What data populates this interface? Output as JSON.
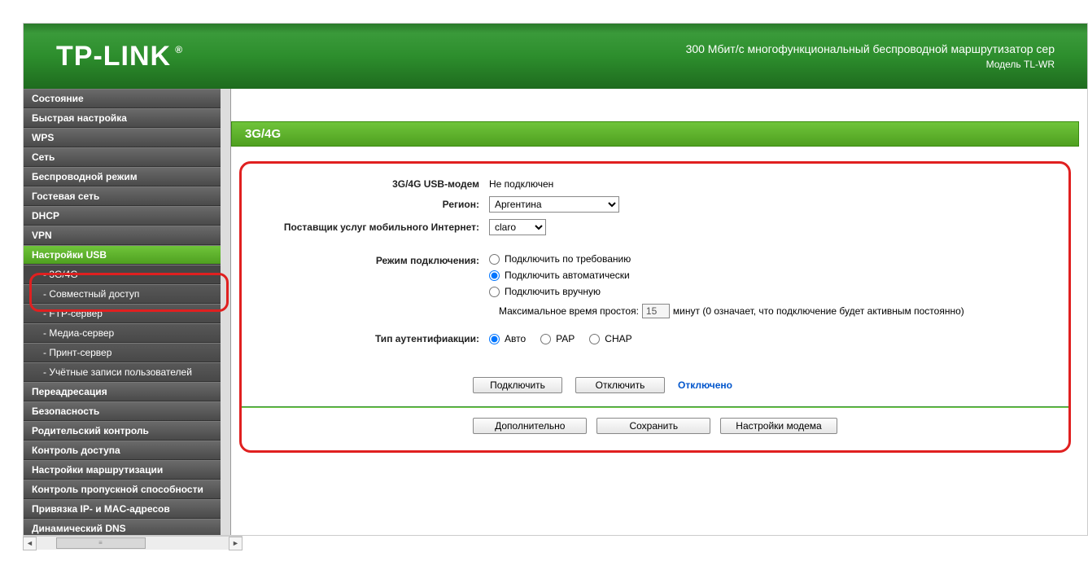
{
  "header": {
    "logo": "TP-LINK",
    "title": "300 Мбит/с многофункциональный беспроводной маршрутизатор сер",
    "model": "Модель TL-WR"
  },
  "sidebar": {
    "items": [
      {
        "label": "Состояние",
        "type": "top"
      },
      {
        "label": "Быстрая настройка",
        "type": "top"
      },
      {
        "label": "WPS",
        "type": "top"
      },
      {
        "label": "Сеть",
        "type": "top"
      },
      {
        "label": "Беспроводной режим",
        "type": "top"
      },
      {
        "label": "Гостевая сеть",
        "type": "top"
      },
      {
        "label": "DHCP",
        "type": "top"
      },
      {
        "label": "VPN",
        "type": "top"
      },
      {
        "label": "Настройки USB",
        "type": "active"
      },
      {
        "label": "- 3G/4G",
        "type": "active_child"
      },
      {
        "label": "- Совместный доступ",
        "type": "child"
      },
      {
        "label": "- FTP-сервер",
        "type": "child"
      },
      {
        "label": "- Медиа-сервер",
        "type": "child"
      },
      {
        "label": "- Принт-сервер",
        "type": "child"
      },
      {
        "label": "- Учётные записи пользователей",
        "type": "child"
      },
      {
        "label": "Переадресация",
        "type": "top"
      },
      {
        "label": "Безопасность",
        "type": "top"
      },
      {
        "label": "Родительский контроль",
        "type": "top"
      },
      {
        "label": "Контроль доступа",
        "type": "top"
      },
      {
        "label": "Настройки маршрутизации",
        "type": "top"
      },
      {
        "label": "Контроль пропускной способности",
        "type": "top"
      },
      {
        "label": "Привязка IP- и MAC-адресов",
        "type": "top"
      },
      {
        "label": "Динамический DNS",
        "type": "top"
      }
    ]
  },
  "section": {
    "title": "3G/4G"
  },
  "form": {
    "modem_label": "3G/4G USB-модем",
    "modem_value": "Не подключен",
    "region_label": "Регион:",
    "region_value": "Аргентина",
    "isp_label": "Поставщик услуг мобильного Интернет:",
    "isp_value": "claro",
    "conn_mode_label": "Режим подключения:",
    "conn_modes": {
      "on_demand": "Подключить по требованию",
      "auto": "Подключить автоматически",
      "manual": "Подключить вручную"
    },
    "idle_label": "Максимальное время простоя:",
    "idle_value": "15",
    "idle_suffix": "минут (0 означает, что подключение будет активным постоянно)",
    "auth_label": "Тип аутентифиакции:",
    "auth": {
      "auto": "Авто",
      "pap": "PAP",
      "chap": "CHAP"
    },
    "buttons": {
      "connect": "Подключить",
      "disconnect": "Отключить",
      "status": "Отключено",
      "advanced": "Дополнительно",
      "save": "Сохранить",
      "modem_settings": "Настройки модема"
    }
  }
}
